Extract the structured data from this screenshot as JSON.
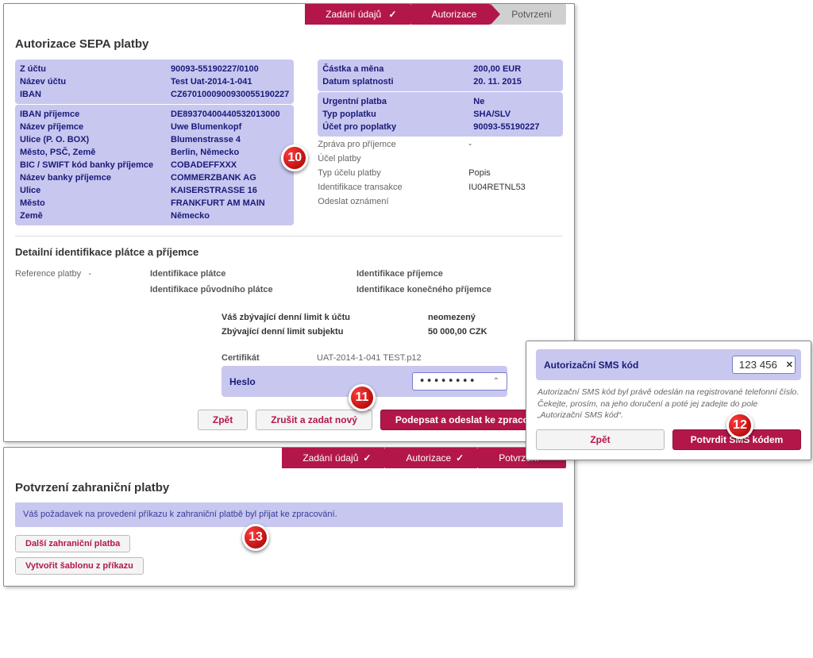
{
  "wizard": {
    "step1": "Zadání údajů",
    "step2": "Autorizace",
    "step3": "Potvrzení",
    "check": "✓"
  },
  "main": {
    "title": "Autorizace SEPA platby",
    "left": {
      "from_account_l": "Z účtu",
      "from_account_v": "90093-55190227/0100",
      "acct_name_l": "Název účtu",
      "acct_name_v": "Test Uat-2014-1-041",
      "iban_l": "IBAN",
      "iban_v": "CZ6701000900930055190227",
      "ben_iban_l": "IBAN příjemce",
      "ben_iban_v": "DE89370400440532013000",
      "ben_name_l": "Název příjemce",
      "ben_name_v": "Uwe Blumenkopf",
      "street_l": "Ulice (P. O. BOX)",
      "street_v": "Blumenstrasse 4",
      "city_l": "Město, PSČ, Země",
      "city_v": "Berlin, Německo",
      "bic_l": "BIC / SWIFT kód banky příjemce",
      "bic_v": "COBADEFFXXX",
      "bank_name_l": "Název banky příjemce",
      "bank_name_v": "COMMERZBANK AG",
      "bank_street_l": "Ulice",
      "bank_street_v": "KAISERSTRASSE 16",
      "bank_city_l": "Město",
      "bank_city_v": "FRANKFURT AM MAIN",
      "country_l": "Země",
      "country_v": "Německo"
    },
    "right": {
      "amount_l": "Částka a měna",
      "amount_v": "200,00 EUR",
      "due_l": "Datum splatnosti",
      "due_v": "20. 11. 2015",
      "urgent_l": "Urgentní platba",
      "urgent_v": "Ne",
      "fee_type_l": "Typ poplatku",
      "fee_type_v": "SHA/SLV",
      "fee_acct_l": "Účet pro poplatky",
      "fee_acct_v": "90093-55190227",
      "msg_l": "Zpráva pro příjemce",
      "msg_v": "-",
      "purpose_l": "Účel platby",
      "purpose_v": "",
      "purpose_type_l": "Typ účelu platby",
      "purpose_type_v": "Popis",
      "txid_l": "Identifikace transakce",
      "txid_v": "IU04RETNL53",
      "notify_l": "Odeslat oznámení",
      "notify_v": ""
    },
    "detail_title": "Detailní identifikace plátce a příjemce",
    "ref_l": "Reference platby",
    "ref_v": "-",
    "id_payer": "Identifikace plátce",
    "id_recipient": "Identifikace příjemce",
    "id_orig_payer": "Identifikace původního plátce",
    "id_final_recipient": "Identifikace konečného příjemce",
    "limit1_l": "Váš zbývající denní limit k účtu",
    "limit1_v": "neomezený",
    "limit2_l": "Zbývající denní limit subjektu",
    "limit2_v": "50 000,00 CZK",
    "cert_l": "Certifikát",
    "cert_v": "UAT-2014-1-041 TEST.p12",
    "pwd_l": "Heslo",
    "pwd_v": "••••••••",
    "btn_back": "Zpět",
    "btn_cancel": "Zrušit a zadat nový",
    "btn_sign": "Podepsat a odeslat ke zpracování"
  },
  "sms": {
    "label": "Autorizační SMS kód",
    "value": "123 456",
    "clear": "✕",
    "text": "Autorizační SMS kód byl právě odeslán na registrované telefonní číslo. Čekejte, prosím, na jeho doručení a poté jej zadejte do pole „Autorizační SMS kód“.",
    "btn_back": "Zpět",
    "btn_confirm": "Potvrdit SMS kódem"
  },
  "confirm": {
    "title": "Potvrzení zahraniční platby",
    "msg": "Váš požadavek na provedení příkazu k zahraniční platbě byl přijat ke zpracování.",
    "btn_next": "Další zahraniční platba",
    "btn_template": "Vytvořit šablonu z příkazu"
  },
  "badges": {
    "b10": "10",
    "b11": "11",
    "b12": "12",
    "b13": "13"
  }
}
